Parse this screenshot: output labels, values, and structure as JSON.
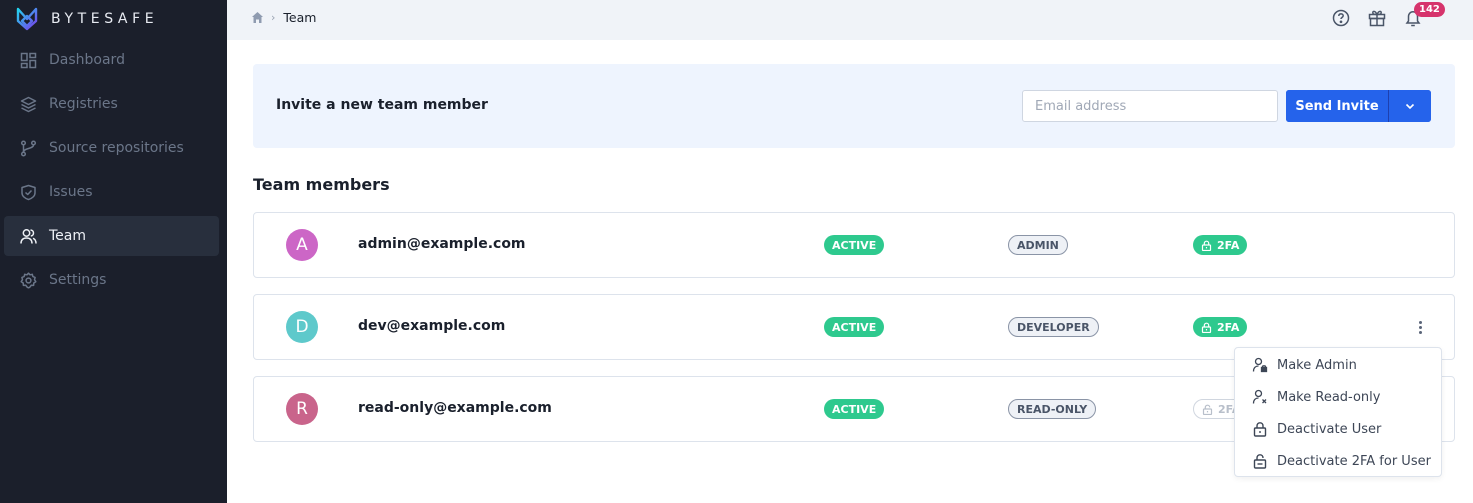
{
  "brand": {
    "name": "BYTESAFE",
    "logo_icon": "bytesafe-logo"
  },
  "sidebar": {
    "items": [
      {
        "label": "Dashboard",
        "icon": "dashboard-icon",
        "active": false
      },
      {
        "label": "Registries",
        "icon": "layers-icon",
        "active": false
      },
      {
        "label": "Source repositories",
        "icon": "git-branch-icon",
        "active": false
      },
      {
        "label": "Issues",
        "icon": "shield-check-icon",
        "active": false
      },
      {
        "label": "Team",
        "icon": "users-icon",
        "active": true
      },
      {
        "label": "Settings",
        "icon": "gear-icon",
        "active": false
      }
    ]
  },
  "topbar": {
    "breadcrumb": {
      "home_icon": "home-icon",
      "current": "Team"
    },
    "icons": [
      "help-icon",
      "gift-icon",
      "bell-icon"
    ],
    "notification_count": "142"
  },
  "invite": {
    "title": "Invite a new team member",
    "email_value": "",
    "email_placeholder": "Email address",
    "send_label": "Send Invite",
    "dropdown_icon": "chevron-down-icon"
  },
  "members_section": {
    "title": "Team members",
    "members": [
      {
        "initial": "A",
        "avatar_color": "#cc66c6",
        "email": "admin@example.com",
        "status": "ACTIVE",
        "role": "ADMIN",
        "tfa": "2FA",
        "tfa_enabled": true
      },
      {
        "initial": "D",
        "avatar_color": "#5ec9cb",
        "email": "dev@example.com",
        "status": "ACTIVE",
        "role": "DEVELOPER",
        "tfa": "2FA",
        "tfa_enabled": true
      },
      {
        "initial": "R",
        "avatar_color": "#c9648b",
        "email": "read-only@example.com",
        "status": "ACTIVE",
        "role": "READ-ONLY",
        "tfa": "2FA",
        "tfa_enabled": false
      }
    ]
  },
  "context_menu": {
    "items": [
      {
        "label": "Make Admin",
        "icon": "user-lock-icon"
      },
      {
        "label": "Make Read-only",
        "icon": "user-x-icon"
      },
      {
        "label": "Deactivate User",
        "icon": "lock-icon"
      },
      {
        "label": "Deactivate 2FA for User",
        "icon": "unlock-icon"
      }
    ]
  },
  "colors": {
    "sidebar_bg": "#1b1f2b",
    "accent": "#2563eb",
    "success": "#2ec98e",
    "notification": "#d6336c"
  }
}
